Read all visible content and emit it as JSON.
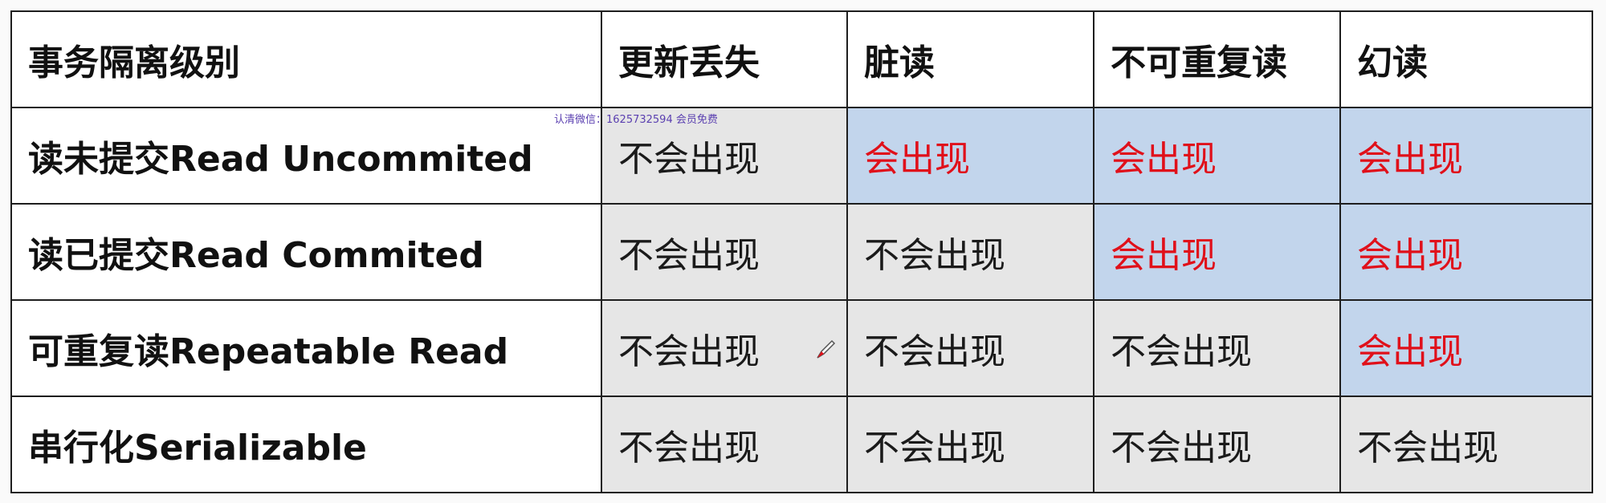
{
  "table": {
    "header": {
      "level": "事务隔离级别",
      "lost_update": "更新丢失",
      "dirty_read": "脏读",
      "non_repeatable": "不可重复读",
      "phantom": "幻读"
    },
    "rows": [
      {
        "name": "读未提交Read Uncommited",
        "lost_update": "不会出现",
        "dirty_read": "会出现",
        "non_repeatable": "会出现",
        "phantom": "会出现"
      },
      {
        "name": "读已提交Read Commited",
        "lost_update": "不会出现",
        "dirty_read": "不会出现",
        "non_repeatable": "会出现",
        "phantom": "会出现"
      },
      {
        "name": "可重复读Repeatable Read",
        "lost_update": "不会出现",
        "dirty_read": "不会出现",
        "non_repeatable": "不会出现",
        "phantom": "会出现"
      },
      {
        "name": "串行化Serializable",
        "lost_update": "不会出现",
        "dirty_read": "不会出现",
        "non_repeatable": "不会出现",
        "phantom": "不会出现"
      }
    ]
  },
  "watermark": "认清微信：1625732594 会员免费",
  "colors": {
    "occurs_text": "#e0101a",
    "occurs_bg": "#c2d5ec",
    "not_occurs_bg": "#e6e6e6"
  },
  "icons": {
    "pen": "pen-icon"
  }
}
